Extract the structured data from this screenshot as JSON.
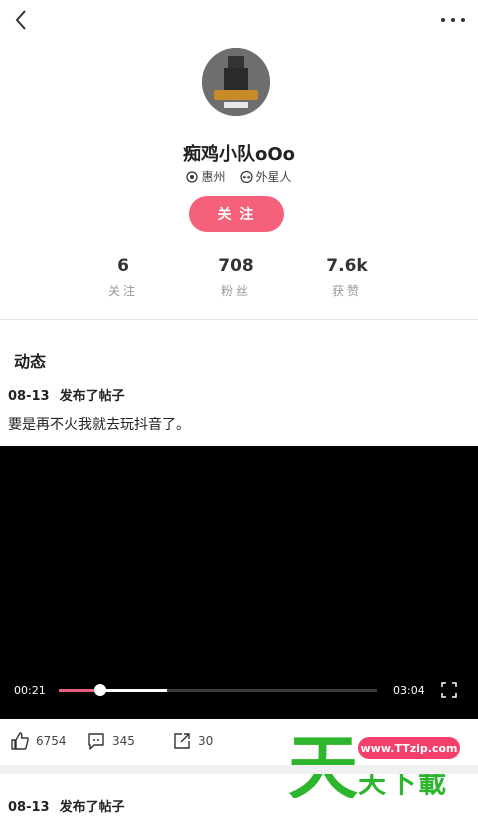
{
  "profile": {
    "name": "痴鸡小队oOo",
    "location": "惠州",
    "tag": "外星人",
    "follow_label": "关 注"
  },
  "stats": [
    {
      "value": "6",
      "label": "关注"
    },
    {
      "value": "708",
      "label": "粉丝"
    },
    {
      "value": "7.6k",
      "label": "获赞"
    }
  ],
  "section_title": "动态",
  "posts": [
    {
      "date": "08-13",
      "action": "发布了帖子",
      "text": "要是再不火我就去玩抖音了。",
      "video": {
        "current": "00:21",
        "duration": "03:04",
        "played_fraction": 0.13,
        "buffered_fraction": 0.34
      },
      "likes": "6754",
      "comments": "345",
      "shares": "30"
    },
    {
      "date": "08-13",
      "action": "发布了帖子"
    }
  ],
  "watermark": {
    "url": "www.TTzip.com",
    "brand_big": "天",
    "brand_small": "天下載",
    "accent": "#2db52d",
    "pill_color": "#f2406b"
  },
  "colors": {
    "follow": "#f5607a",
    "progress": "#e8607a"
  },
  "icons": {
    "back": "chevron-left-icon",
    "more": "more-dots-icon",
    "location": "location-pin-icon",
    "alien": "alien-icon",
    "like": "thumbs-up-icon",
    "comment": "comment-icon",
    "share": "share-icon",
    "fullscreen": "fullscreen-icon"
  }
}
